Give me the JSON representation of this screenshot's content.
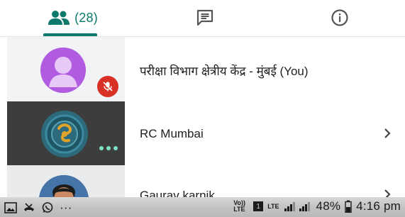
{
  "tabs": {
    "people_count": "(28)",
    "active_tab": "people"
  },
  "participants": [
    {
      "name": "परीक्षा विभाग क्षेत्रीय केंद्र - मुंबई (You)",
      "muted": true,
      "avatar": "default-user-icon"
    },
    {
      "name": "RC Mumbai",
      "avatar": "organization-logo",
      "status": "more-options-dots"
    },
    {
      "name": "Gaurav karnik",
      "avatar": "user-photo"
    }
  ],
  "status_bar": {
    "dots": "···",
    "network_small": "Vo)) LTE",
    "sim_badge": "1",
    "lte": "LTE",
    "battery_percent": "48%",
    "time": "4:16 pm"
  },
  "colors": {
    "accent": "#0b7a6b",
    "mute_red": "#d93025",
    "avatar_purple": "#b15be0"
  }
}
